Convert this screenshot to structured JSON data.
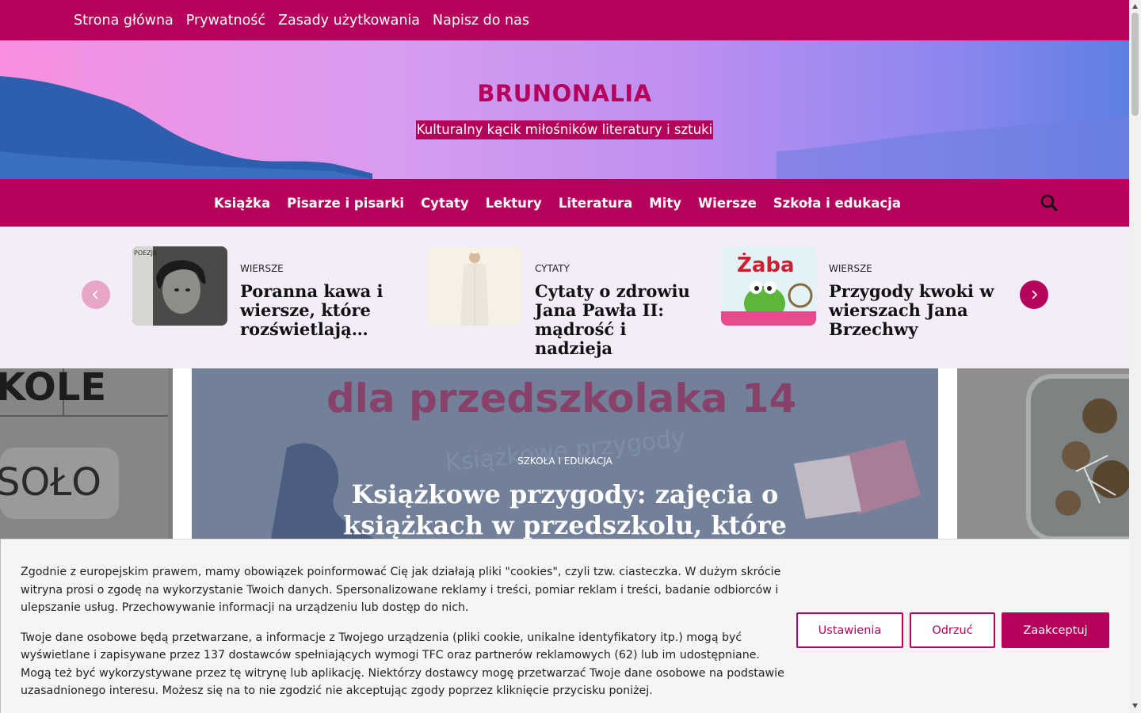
{
  "topnav": {
    "items": [
      "Strona główna",
      "Prywatność",
      "Zasady użytkowania",
      "Napisz do nas"
    ]
  },
  "header": {
    "site_title": "BRUNONALIA",
    "tagline": "Kulturalny kącik miłośników literatury i sztuki"
  },
  "mainnav": {
    "items": [
      "Książka",
      "Pisarze i pisarki",
      "Cytaty",
      "Lektury",
      "Literatura",
      "Mity",
      "Wiersze",
      "Szkoła i edukacja"
    ],
    "search_icon": "search-icon"
  },
  "slider": {
    "cards": [
      {
        "category": "WIERSZE",
        "title_lines": [
          "Poranna kawa i",
          "wiersze, które",
          "rozświetlają…"
        ],
        "thumb_text": "POEZJA"
      },
      {
        "category": "CYTATY",
        "title_lines": [
          "Cytaty o zdrowiu",
          "Jana Pawła II:",
          "mądrość i nadzieja"
        ]
      },
      {
        "category": "WIERSZE",
        "title_lines": [
          "Przygody kwoki w",
          "wierszach Jana",
          "Brzechwy"
        ],
        "thumb_text": "Żaba"
      }
    ],
    "prev_icon": "chevron-left-icon",
    "next_icon": "chevron-right-icon"
  },
  "hero": {
    "left_text_1": "KOLE",
    "left_text_2": "SOŁO",
    "image_text": "dla przedszkolaka 14",
    "image_subtext": "Książkowe przygody",
    "category": "SZKOŁA I EDUKACJA",
    "title_lines": [
      "Książkowe przygody: zajęcia o",
      "książkach w przedszkolu, które"
    ]
  },
  "cookie": {
    "paragraph_1": "Zgodnie z europejskim prawem, mamy obowiązek poinformować Cię jak działają pliki \"cookies\", czyli tzw. ciasteczka. W dużym skrócie witryna prosi o zgodę na wykorzystanie Twoich danych. Spersonalizowane reklamy i treści, pomiar reklam i treści, badanie odbiorców i ulepszanie usług. Przechowywanie informacji na urządzeniu lub dostęp do nich.",
    "paragraph_2": "Twoje dane osobowe będą przetwarzane, a informacje z Twojego urządzenia (pliki cookie, unikalne identyfikatory itp.) mogą być wyświetlane i zapisywane przez 137 dostawców spełniających wymogi TFC oraz partnerów reklamowych (62) lub im udostępniane. Mogą też być wykorzystywane przez tę witrynę lub aplikację. Niektórzy dostawcy mogę przetwarzać Twoje dane osobowe na podstawie uzasadnionego interesu. Możesz się na to nie zgodzić nie akceptując zgody poprzez kliknięcie przycisku poniżej.",
    "settings_label": "Ustawienia",
    "reject_label": "Odrzuć",
    "accept_label": "Zaakceptuj"
  },
  "colors": {
    "brand": "#b5025a",
    "slider_bg": "#f3edf9",
    "cookie_bg": "#f5f5f5"
  }
}
